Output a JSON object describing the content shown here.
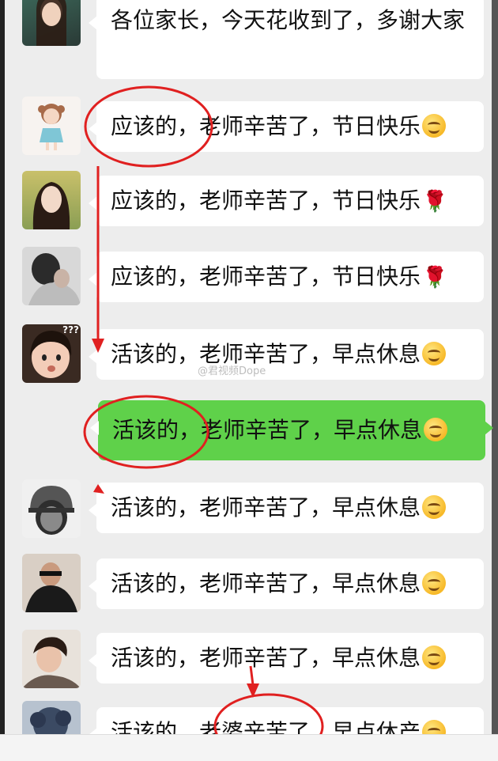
{
  "messages": [
    {
      "text": "各位家长，今天花收到了，多谢大家",
      "avatar": "avatar-girl-photo",
      "suffix": ""
    },
    {
      "text": "应该的，老师辛苦了，节日快乐",
      "avatar": "avatar-cartoon-girl",
      "suffix": "smile-emoji"
    },
    {
      "text": "应该的，老师辛苦了，节日快乐",
      "avatar": "avatar-woman-photo",
      "suffix": "rose-emoji"
    },
    {
      "text": "应该的，老师辛苦了，节日快乐",
      "avatar": "avatar-person-photo",
      "suffix": "rose-emoji"
    },
    {
      "text": "活该的，老师辛苦了，早点休息",
      "avatar": "avatar-child-photo",
      "suffix": "smile-emoji"
    },
    {
      "text": "活该的，老师辛苦了，早点休息",
      "avatar": "",
      "suffix": "smile-emoji",
      "self": true
    },
    {
      "text": "活该的，老师辛苦了，早点休息",
      "avatar": "avatar-helmet-sketch",
      "suffix": "smile-emoji"
    },
    {
      "text": "活该的，老师辛苦了，早点休息",
      "avatar": "avatar-man-photo",
      "suffix": "smile-emoji"
    },
    {
      "text": "活该的，老师辛苦了，早点休息",
      "avatar": "avatar-woman-photo-2",
      "suffix": "smile-emoji"
    },
    {
      "text": "活该的，老婆辛苦了，早点休产",
      "avatar": "avatar-curly-photo",
      "suffix": "smile-emoji"
    }
  ],
  "rose_glyph": "🌹",
  "avatar_badge": "???",
  "watermark": "@君视频Dope",
  "colors": {
    "self_bubble": "#5fd14a",
    "annotation": "#e02020"
  }
}
